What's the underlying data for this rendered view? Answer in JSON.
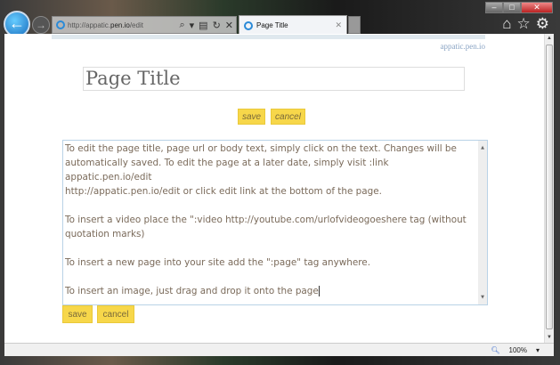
{
  "browser": {
    "address_prefix": "http://appatic.",
    "address_domain": "pen.io",
    "address_suffix": "/edit",
    "tab_title": "Page Title",
    "zoom": "100%"
  },
  "page": {
    "site_link": "appatic.pen.io",
    "title": "Page Title",
    "top_save": "save",
    "top_cancel": "cancel",
    "body_paragraphs": [
      "To edit the page title, page url or body text, simply click on the text. Changes will be",
      "automatically saved. To edit the page at a later date, simply visit :link appatic.pen.io/edit",
      "http://appatic.pen.io/edit or click edit link at the bottom of the page.",
      "To insert a video place the \":video http://youtube.com/urlofvideogoeshere tag (without",
      "quotation marks)",
      "To insert a new page into your site add the \":page\" tag anywhere.",
      "To insert an image, just drag and drop it onto the page"
    ],
    "bottom_save": "save",
    "bottom_cancel": "cancel"
  }
}
